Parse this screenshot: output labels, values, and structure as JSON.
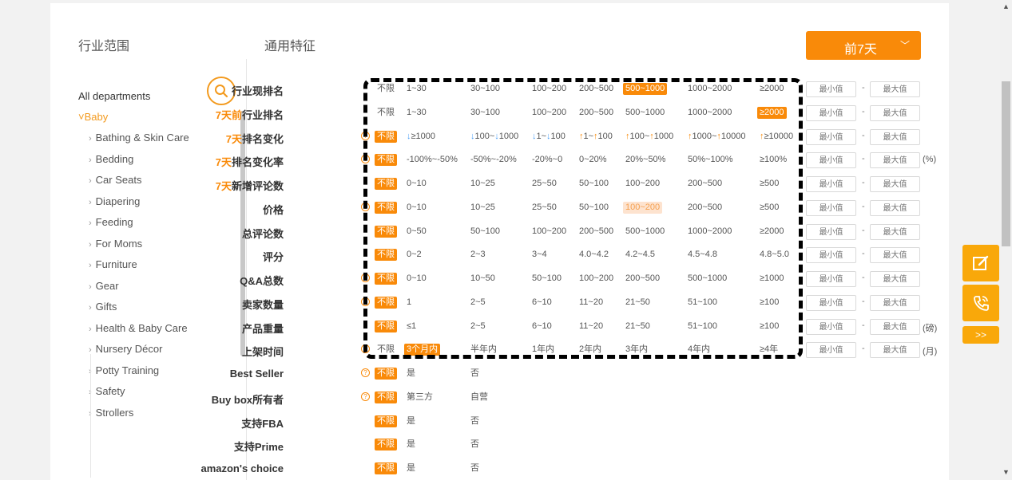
{
  "left": {
    "title": "行业范围",
    "all": "All departments",
    "category": "Baby",
    "subcategories": [
      "Bathing & Skin Care",
      "Bedding",
      "Car Seats",
      "Diapering",
      "Feeding",
      "For Moms",
      "Furniture",
      "Gear",
      "Gifts",
      "Health & Baby Care",
      "Nursery Décor",
      "Potty Training",
      "Safety",
      "Strollers"
    ]
  },
  "main": {
    "title": "通用特征",
    "period": "前7天",
    "range_placeholder_min": "最小值",
    "range_placeholder_max": "最大值",
    "rows": [
      {
        "label": "行业现排名",
        "options": [
          "不限",
          "1~30",
          "30~100",
          "100~200",
          "200~500",
          "500~1000",
          "1000~2000",
          "≥2000"
        ]
      },
      {
        "label_hl": "7天前",
        "label": "行业排名",
        "options": [
          "不限",
          "1~30",
          "30~100",
          "100~200",
          "200~500",
          "500~1000",
          "1000~2000",
          "≥2000"
        ]
      },
      {
        "label_hl": "7天",
        "label": "排名变化",
        "options": [
          "不限",
          "↓≥1000",
          "↓100~↓1000",
          "↓1~↓100",
          "↑1~↑100",
          "↑100~↑1000",
          "↑1000~↑10000",
          "↑≥10000"
        ]
      },
      {
        "label_hl": "7天",
        "label": "排名变化率",
        "options": [
          "不限",
          "-100%~-50%",
          "-50%~-20%",
          "-20%~0",
          "0~20%",
          "20%~50%",
          "50%~100%",
          "≥100%"
        ],
        "unit": "(%)"
      },
      {
        "label_hl": "7天",
        "label": "新增评论数",
        "options": [
          "不限",
          "0~10",
          "10~25",
          "25~50",
          "50~100",
          "100~200",
          "200~500",
          "≥500"
        ]
      },
      {
        "label": "价格",
        "options": [
          "不限",
          "0~10",
          "10~25",
          "25~50",
          "50~100",
          "100~200",
          "200~500",
          "≥500"
        ]
      },
      {
        "label": "总评论数",
        "options": [
          "不限",
          "0~50",
          "50~100",
          "100~200",
          "200~500",
          "500~1000",
          "1000~2000",
          "≥2000"
        ]
      },
      {
        "label": "评分",
        "options": [
          "不限",
          "0~2",
          "2~3",
          "3~4",
          "4.0~4.2",
          "4.2~4.5",
          "4.5~4.8",
          "4.8~5.0"
        ]
      },
      {
        "label": "Q&A总数",
        "options": [
          "不限",
          "0~10",
          "10~50",
          "50~100",
          "100~200",
          "200~500",
          "500~1000",
          "≥1000"
        ]
      },
      {
        "label": "卖家数量",
        "options": [
          "不限",
          "1",
          "2~5",
          "6~10",
          "11~20",
          "21~50",
          "51~100",
          "≥100"
        ]
      },
      {
        "label": "产品重量",
        "options": [
          "不限",
          "≤1",
          "2~5",
          "6~10",
          "11~20",
          "21~50",
          "51~100",
          "≥100"
        ],
        "unit": "(磅)"
      },
      {
        "label": "上架时间",
        "options": [
          "不限",
          "3个月内",
          "半年内",
          "1年内",
          "2年内",
          "3年内",
          "4年内",
          "≥4年"
        ],
        "unit": "(月)"
      },
      {
        "label": "Best Seller",
        "options": [
          "不限",
          "是",
          "否"
        ]
      },
      {
        "label": "Buy box所有者",
        "options": [
          "不限",
          "第三方",
          "自营"
        ]
      },
      {
        "label": "支持FBA",
        "options": [
          "不限",
          "是",
          "否"
        ]
      },
      {
        "label": "支持Prime",
        "options": [
          "不限",
          "是",
          "否"
        ]
      },
      {
        "label": "amazon's choice",
        "options": [
          "不限",
          "是",
          "否"
        ]
      }
    ]
  },
  "side": {
    "more": ">>"
  },
  "colors": {
    "accent": "#f98a09",
    "accent_soft": "#fde3cf",
    "link_blue": "#4a9ef7"
  }
}
